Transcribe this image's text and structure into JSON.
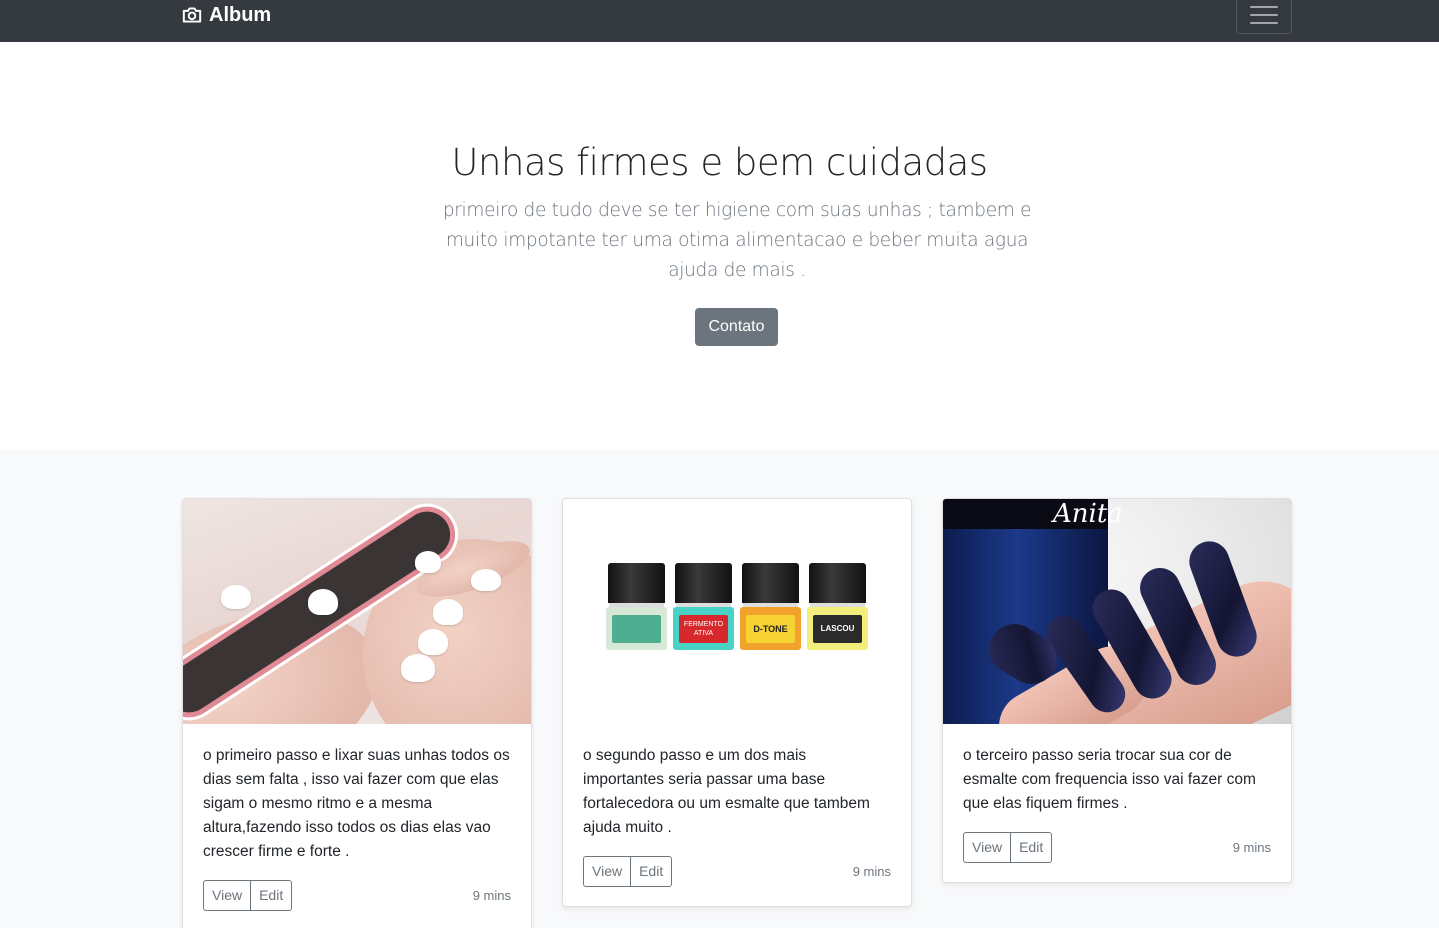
{
  "navbar": {
    "brand": "Album",
    "brand_icon": "camera-icon",
    "toggler_icon": "hamburger-icon"
  },
  "hero": {
    "title": "Unhas firmes e bem cuidadas",
    "lead": "primeiro de tudo deve se ter higiene com suas unhas ; tambem e muito impotante ter uma otima alimentacao e beber muita agua ajuda de mais .",
    "button": "Contato"
  },
  "cards": [
    {
      "text": "o primeiro passo e lixar suas unhas todos os dias sem falta , isso vai fazer com que elas sigam o mesmo ritmo e a mesma altura,fazendo isso todos os dias elas vao crescer firme e forte .",
      "view": "View",
      "edit": "Edit",
      "time": "9 mins"
    },
    {
      "text": "o segundo passo e um dos mais importantes seria passar uma base fortalecedora ou um esmalte que tambem ajuda muito .",
      "view": "View",
      "edit": "Edit",
      "time": "9 mins",
      "bottles": [
        {
          "glass": "#d8e8d6",
          "label": "#4fae8f",
          "text": ""
        },
        {
          "glass": "#49d3c7",
          "label": "#d6282d",
          "text": "FERMENTO ATIVA"
        },
        {
          "glass": "#f2a22a",
          "label": "#f6d232",
          "text": "D-TONE"
        },
        {
          "glass": "#f3ee7c",
          "label": "#2b2b2b",
          "text": "LASCOU"
        }
      ]
    },
    {
      "text": "o terceiro passo seria trocar sua cor de esmalte com frequencia isso vai fazer com que elas fiquem firmes .",
      "view": "View",
      "edit": "Edit",
      "time": "9 mins",
      "bottle_brand": "Anita"
    }
  ],
  "colors": {
    "navbar": "#343a40",
    "secondary": "#6c757d",
    "album_bg": "#f8f9fa"
  }
}
